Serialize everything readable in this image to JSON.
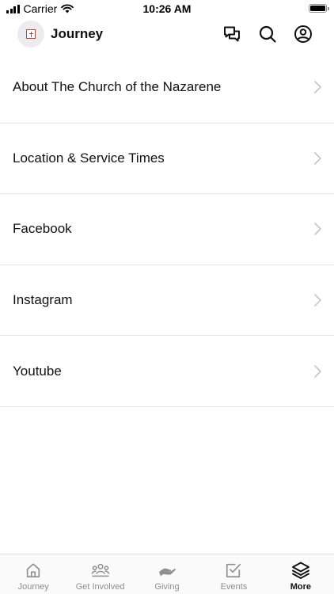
{
  "status_bar": {
    "carrier": "Carrier",
    "time": "10:26 AM"
  },
  "header": {
    "title": "Journey",
    "icons": [
      "chat-icon",
      "search-icon",
      "profile-icon"
    ]
  },
  "menu": {
    "items": [
      {
        "label": "About The Church of the Nazarene"
      },
      {
        "label": "Location & Service Times"
      },
      {
        "label": "Facebook"
      },
      {
        "label": "Instagram"
      },
      {
        "label": "Youtube"
      }
    ]
  },
  "tabs": {
    "active": "More",
    "items": [
      {
        "label": "Journey",
        "icon": "home-icon"
      },
      {
        "label": "Get Involved",
        "icon": "group-icon"
      },
      {
        "label": "Giving",
        "icon": "giving-hand-icon"
      },
      {
        "label": "Events",
        "icon": "checkbox-icon"
      },
      {
        "label": "More",
        "icon": "layers-icon"
      }
    ]
  },
  "colors": {
    "text": "#111111",
    "inactive_tab": "#8e8e93",
    "divider": "#e6e6e6",
    "avatar_bg": "#ecebef",
    "logo": "#b04a3c"
  }
}
